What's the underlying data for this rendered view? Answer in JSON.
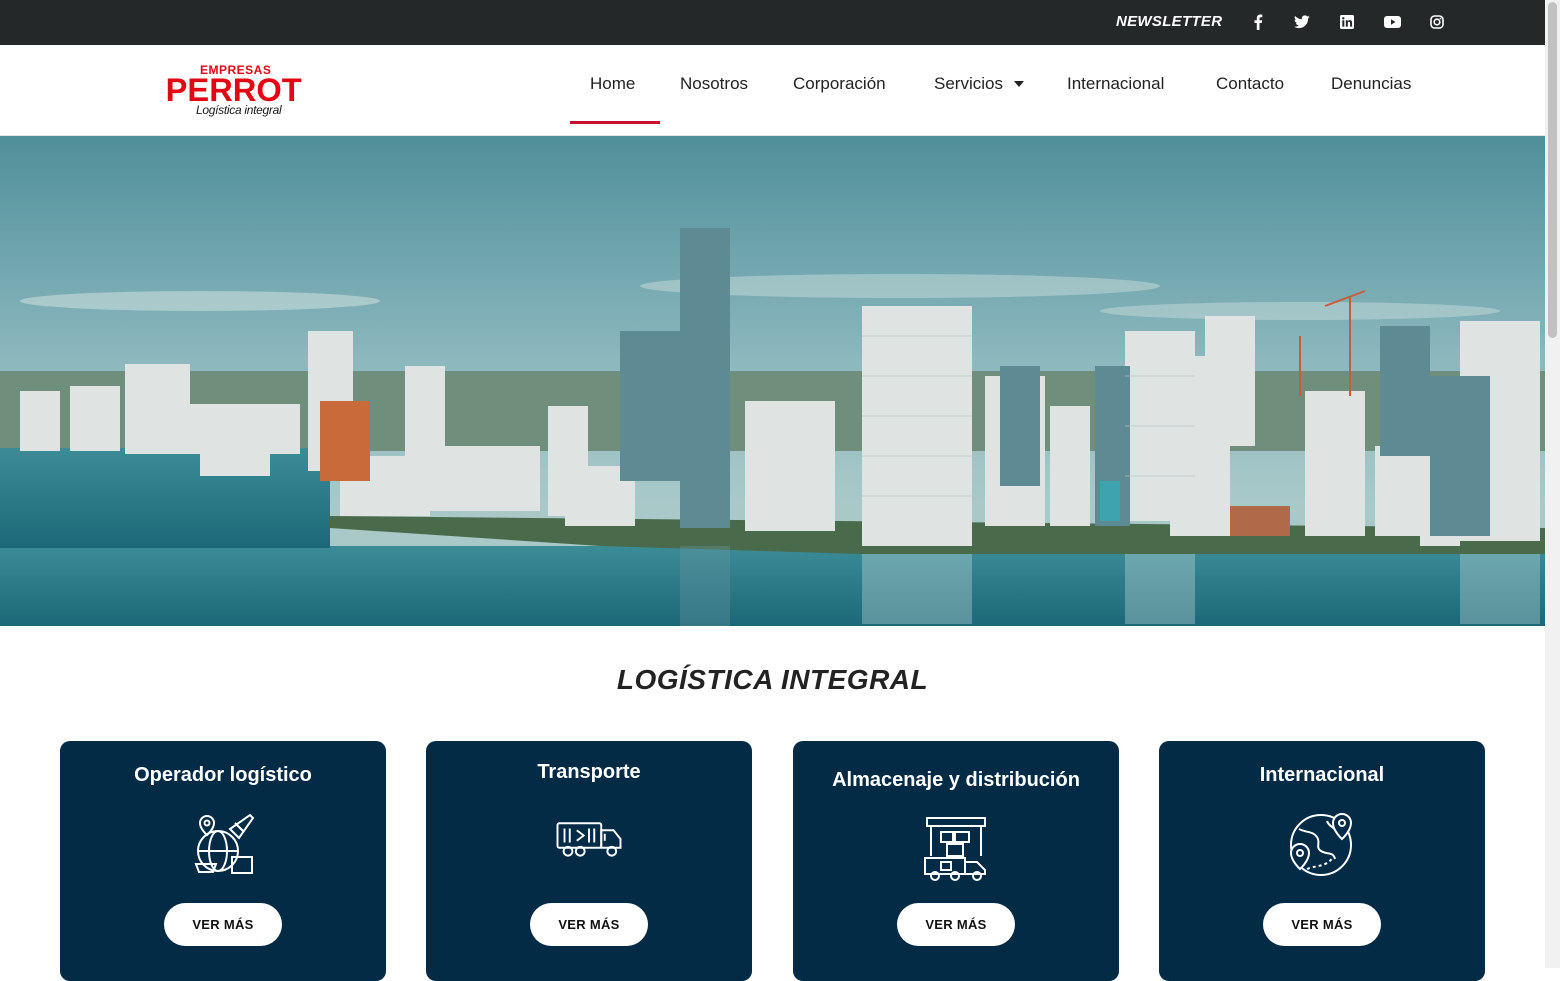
{
  "topbar": {
    "newsletter_label": "NEWSLETTER",
    "social_icons": [
      "facebook-icon",
      "twitter-icon",
      "linkedin-icon",
      "youtube-icon",
      "instagram-icon"
    ]
  },
  "logo": {
    "top_text": "EMPRESAS",
    "brand": "PERROT",
    "tagline": "Logística integral"
  },
  "nav": {
    "items": [
      "Home",
      "Nosotros",
      "Corporación",
      "Servicios",
      "Internacional",
      "Contacto",
      "Denuncias"
    ],
    "active": "Home"
  },
  "section": {
    "title": "LOGÍSTICA INTEGRAL"
  },
  "cards": [
    {
      "title": "Operador logístico",
      "icon": "logistics-globe-icon",
      "button": "VER MÁS"
    },
    {
      "title": "Transporte",
      "icon": "truck-icon",
      "button": "VER MÁS"
    },
    {
      "title": "Almacenaje y distribución",
      "icon": "warehouse-truck-icon",
      "button": "VER MÁS"
    },
    {
      "title": "Internacional",
      "icon": "globe-pins-icon",
      "button": "VER MÁS"
    }
  ],
  "colors": {
    "topbar_bg": "#252829",
    "brand_red": "#e30613",
    "active_underline": "#c8102e",
    "card_bg": "#032b46"
  }
}
